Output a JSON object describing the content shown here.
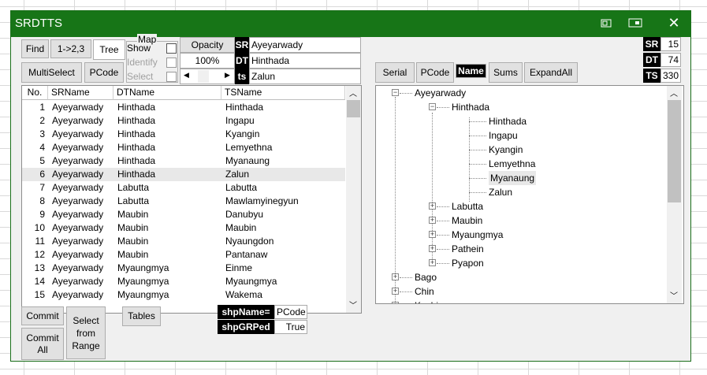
{
  "window": {
    "title": "SRDTTS"
  },
  "toolbar": {
    "find": "Find",
    "cycle": "1->2,3",
    "tree": "Tree",
    "multiselect": "MultiSelect",
    "pcode": "PCode"
  },
  "map": {
    "label": "Map",
    "show": "Show",
    "identify": "Identify",
    "select": "Select"
  },
  "opacity": {
    "label": "Opacity",
    "value": "100%"
  },
  "selection": {
    "sr_tag": "SR",
    "sr_value": "Ayeyarwady",
    "dt_tag": "DT",
    "dt_value": "Hinthada",
    "ts_tag": "ts",
    "ts_value": "Zalun"
  },
  "counts": {
    "sr_tag": "SR",
    "sr_value": "15",
    "dt_tag": "DT",
    "dt_value": "74",
    "ts_tag": "TS",
    "ts_value": "330"
  },
  "tree_toolbar": {
    "serial": "Serial",
    "pcode": "PCode",
    "name": "Name",
    "sums": "Sums",
    "expandall": "ExpandAll"
  },
  "table": {
    "columns": [
      "No.",
      "SRName",
      "DTName",
      "TSName"
    ],
    "rows": [
      [
        "1",
        "Ayeyarwady",
        "Hinthada",
        "Hinthada"
      ],
      [
        "2",
        "Ayeyarwady",
        "Hinthada",
        "Ingapu"
      ],
      [
        "3",
        "Ayeyarwady",
        "Hinthada",
        "Kyangin"
      ],
      [
        "4",
        "Ayeyarwady",
        "Hinthada",
        "Lemyethna"
      ],
      [
        "5",
        "Ayeyarwady",
        "Hinthada",
        "Myanaung"
      ],
      [
        "6",
        "Ayeyarwady",
        "Hinthada",
        "Zalun"
      ],
      [
        "7",
        "Ayeyarwady",
        "Labutta",
        "Labutta"
      ],
      [
        "8",
        "Ayeyarwady",
        "Labutta",
        "Mawlamyinegyun"
      ],
      [
        "9",
        "Ayeyarwady",
        "Maubin",
        "Danubyu"
      ],
      [
        "10",
        "Ayeyarwady",
        "Maubin",
        "Maubin"
      ],
      [
        "11",
        "Ayeyarwady",
        "Maubin",
        "Nyaungdon"
      ],
      [
        "12",
        "Ayeyarwady",
        "Maubin",
        "Pantanaw"
      ],
      [
        "13",
        "Ayeyarwady",
        "Myaungmya",
        "Einme"
      ],
      [
        "14",
        "Ayeyarwady",
        "Myaungmya",
        "Myaungmya"
      ],
      [
        "15",
        "Ayeyarwady",
        "Myaungmya",
        "Wakema"
      ]
    ]
  },
  "tree": {
    "root": "Ayeyarwady",
    "district": "Hinthada",
    "townships": [
      "Hinthada",
      "Ingapu",
      "Kyangin",
      "Lemyethna",
      "Myanaung",
      "Zalun"
    ],
    "other_districts": [
      "Labutta",
      "Maubin",
      "Myaungmya",
      "Pathein",
      "Pyapon"
    ],
    "other_regions": [
      "Bago",
      "Chin",
      "Kachin"
    ]
  },
  "bottom": {
    "commit": "Commit",
    "commit_all_1": "Commit",
    "commit_all_2": "All",
    "select_range_1": "Select",
    "select_range_2": "from",
    "select_range_3": "Range",
    "tables": "Tables",
    "shpname_tag": "shpName=",
    "shpname_value": "PCode",
    "shpgrped_tag": "shpGRPed",
    "shpgrped_value": "True"
  },
  "icons": [
    "restore-icon",
    "window-icon",
    "close-icon",
    "scroll-up-icon",
    "scroll-down-icon",
    "scroll-left-icon",
    "scroll-right-icon"
  ]
}
